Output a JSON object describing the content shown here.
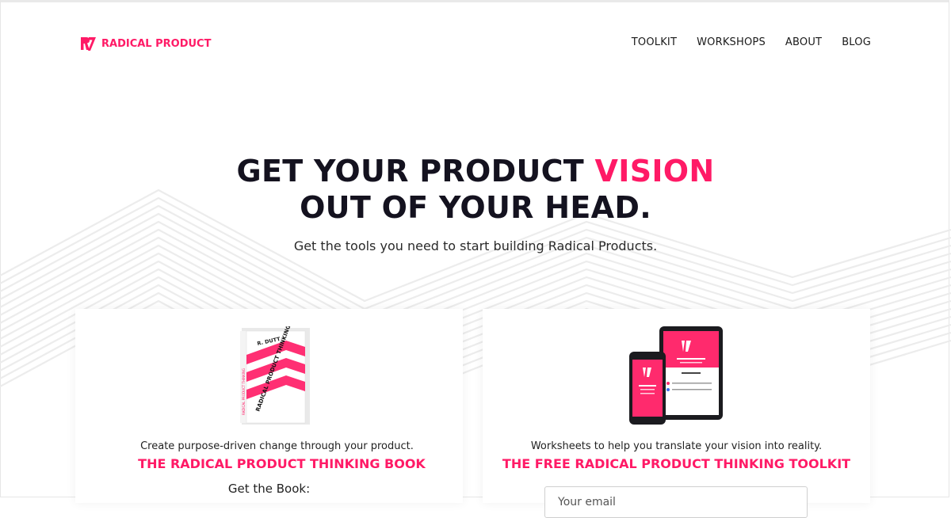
{
  "brand": {
    "name": "RADICAL PRODUCT",
    "color": "#ff1a66",
    "logo_icon": "radical-product-logo-icon"
  },
  "nav": {
    "items": [
      {
        "label": "TOOLKIT"
      },
      {
        "label": "WORKSHOPS"
      },
      {
        "label": "ABOUT"
      },
      {
        "label": "BLOG"
      }
    ]
  },
  "hero": {
    "title_part1": "GET YOUR PRODUCT ",
    "title_accent": "VISION",
    "title_line2": "OUT OF YOUR HEAD.",
    "subtitle": "Get the tools you need to start building Radical Products."
  },
  "cards": {
    "book": {
      "description": "Create purpose-driven change through your product.",
      "title": "THE RADICAL PRODUCT THINKING BOOK",
      "cta": "Get the Book:",
      "image_icon": "book-cover-image",
      "cover_text": {
        "author": "R. DUTT",
        "title": "RADICAL PRODUCT THINKING",
        "spine": "RADICAL PRODUCT THINKING"
      }
    },
    "toolkit": {
      "description": "Worksheets to help you translate your vision into reality.",
      "title": "THE FREE RADICAL PRODUCT THINKING TOOLKIT",
      "email_placeholder": "Your email",
      "image_icon": "phone-and-tablet-image"
    }
  }
}
